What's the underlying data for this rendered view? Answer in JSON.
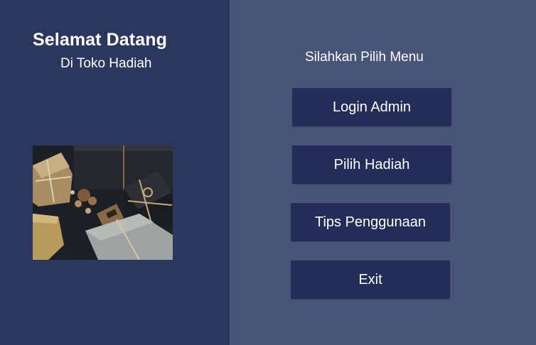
{
  "welcome": {
    "title": "Selamat Datang",
    "subtitle": "Di Toko Hadiah"
  },
  "menu": {
    "prompt": "Silahkan Pilih Menu",
    "buttons": [
      {
        "label": "Login Admin"
      },
      {
        "label": "Pilih Hadiah"
      },
      {
        "label": "Tips Penggunaan"
      },
      {
        "label": "Exit"
      }
    ]
  },
  "colors": {
    "left_panel_bg": "#2c375e",
    "right_panel_bg": "#485478",
    "button_bg": "#232d58",
    "text": "#ffffff"
  },
  "image": {
    "subject": "wrapped-gift-boxes-photo"
  }
}
